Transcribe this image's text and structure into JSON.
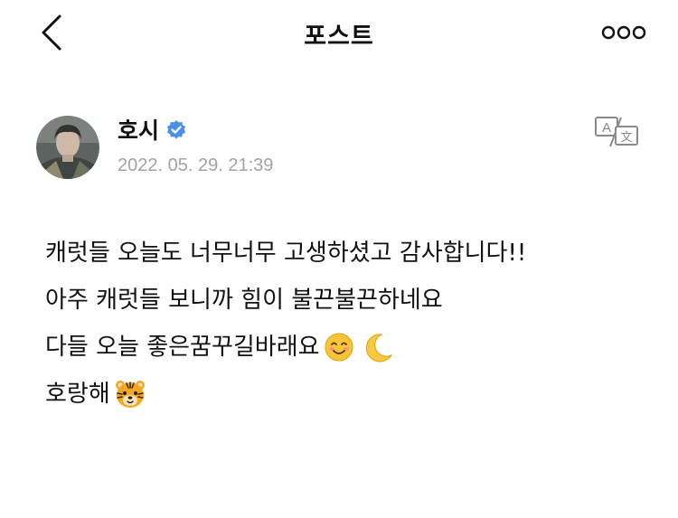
{
  "header": {
    "title": "포스트",
    "back_icon": "chevron-left-icon",
    "more_icon": "more-dots-icon"
  },
  "post": {
    "author": {
      "name": "호시",
      "verified": true,
      "avatar_icon": "avatar-photo"
    },
    "timestamp": "2022. 05. 29. 21:39",
    "translate_icon": "translate-icon",
    "lines": [
      "캐럿들 오늘도 너무너무 고생하셨고 감사합니다!!",
      "아주 캐럿들 보니까 힘이 불끈불끈하네요",
      "다들 오늘 좋은꿈꾸길바래요",
      "호랑해"
    ],
    "emojis": [
      "smiling-face-icon",
      "crescent-moon-icon",
      "tiger-face-icon"
    ]
  },
  "colors": {
    "verified_blue": "#4a90e8",
    "timestamp_gray": "#a3a3a3",
    "icon_gray": "#8a8a8a"
  }
}
